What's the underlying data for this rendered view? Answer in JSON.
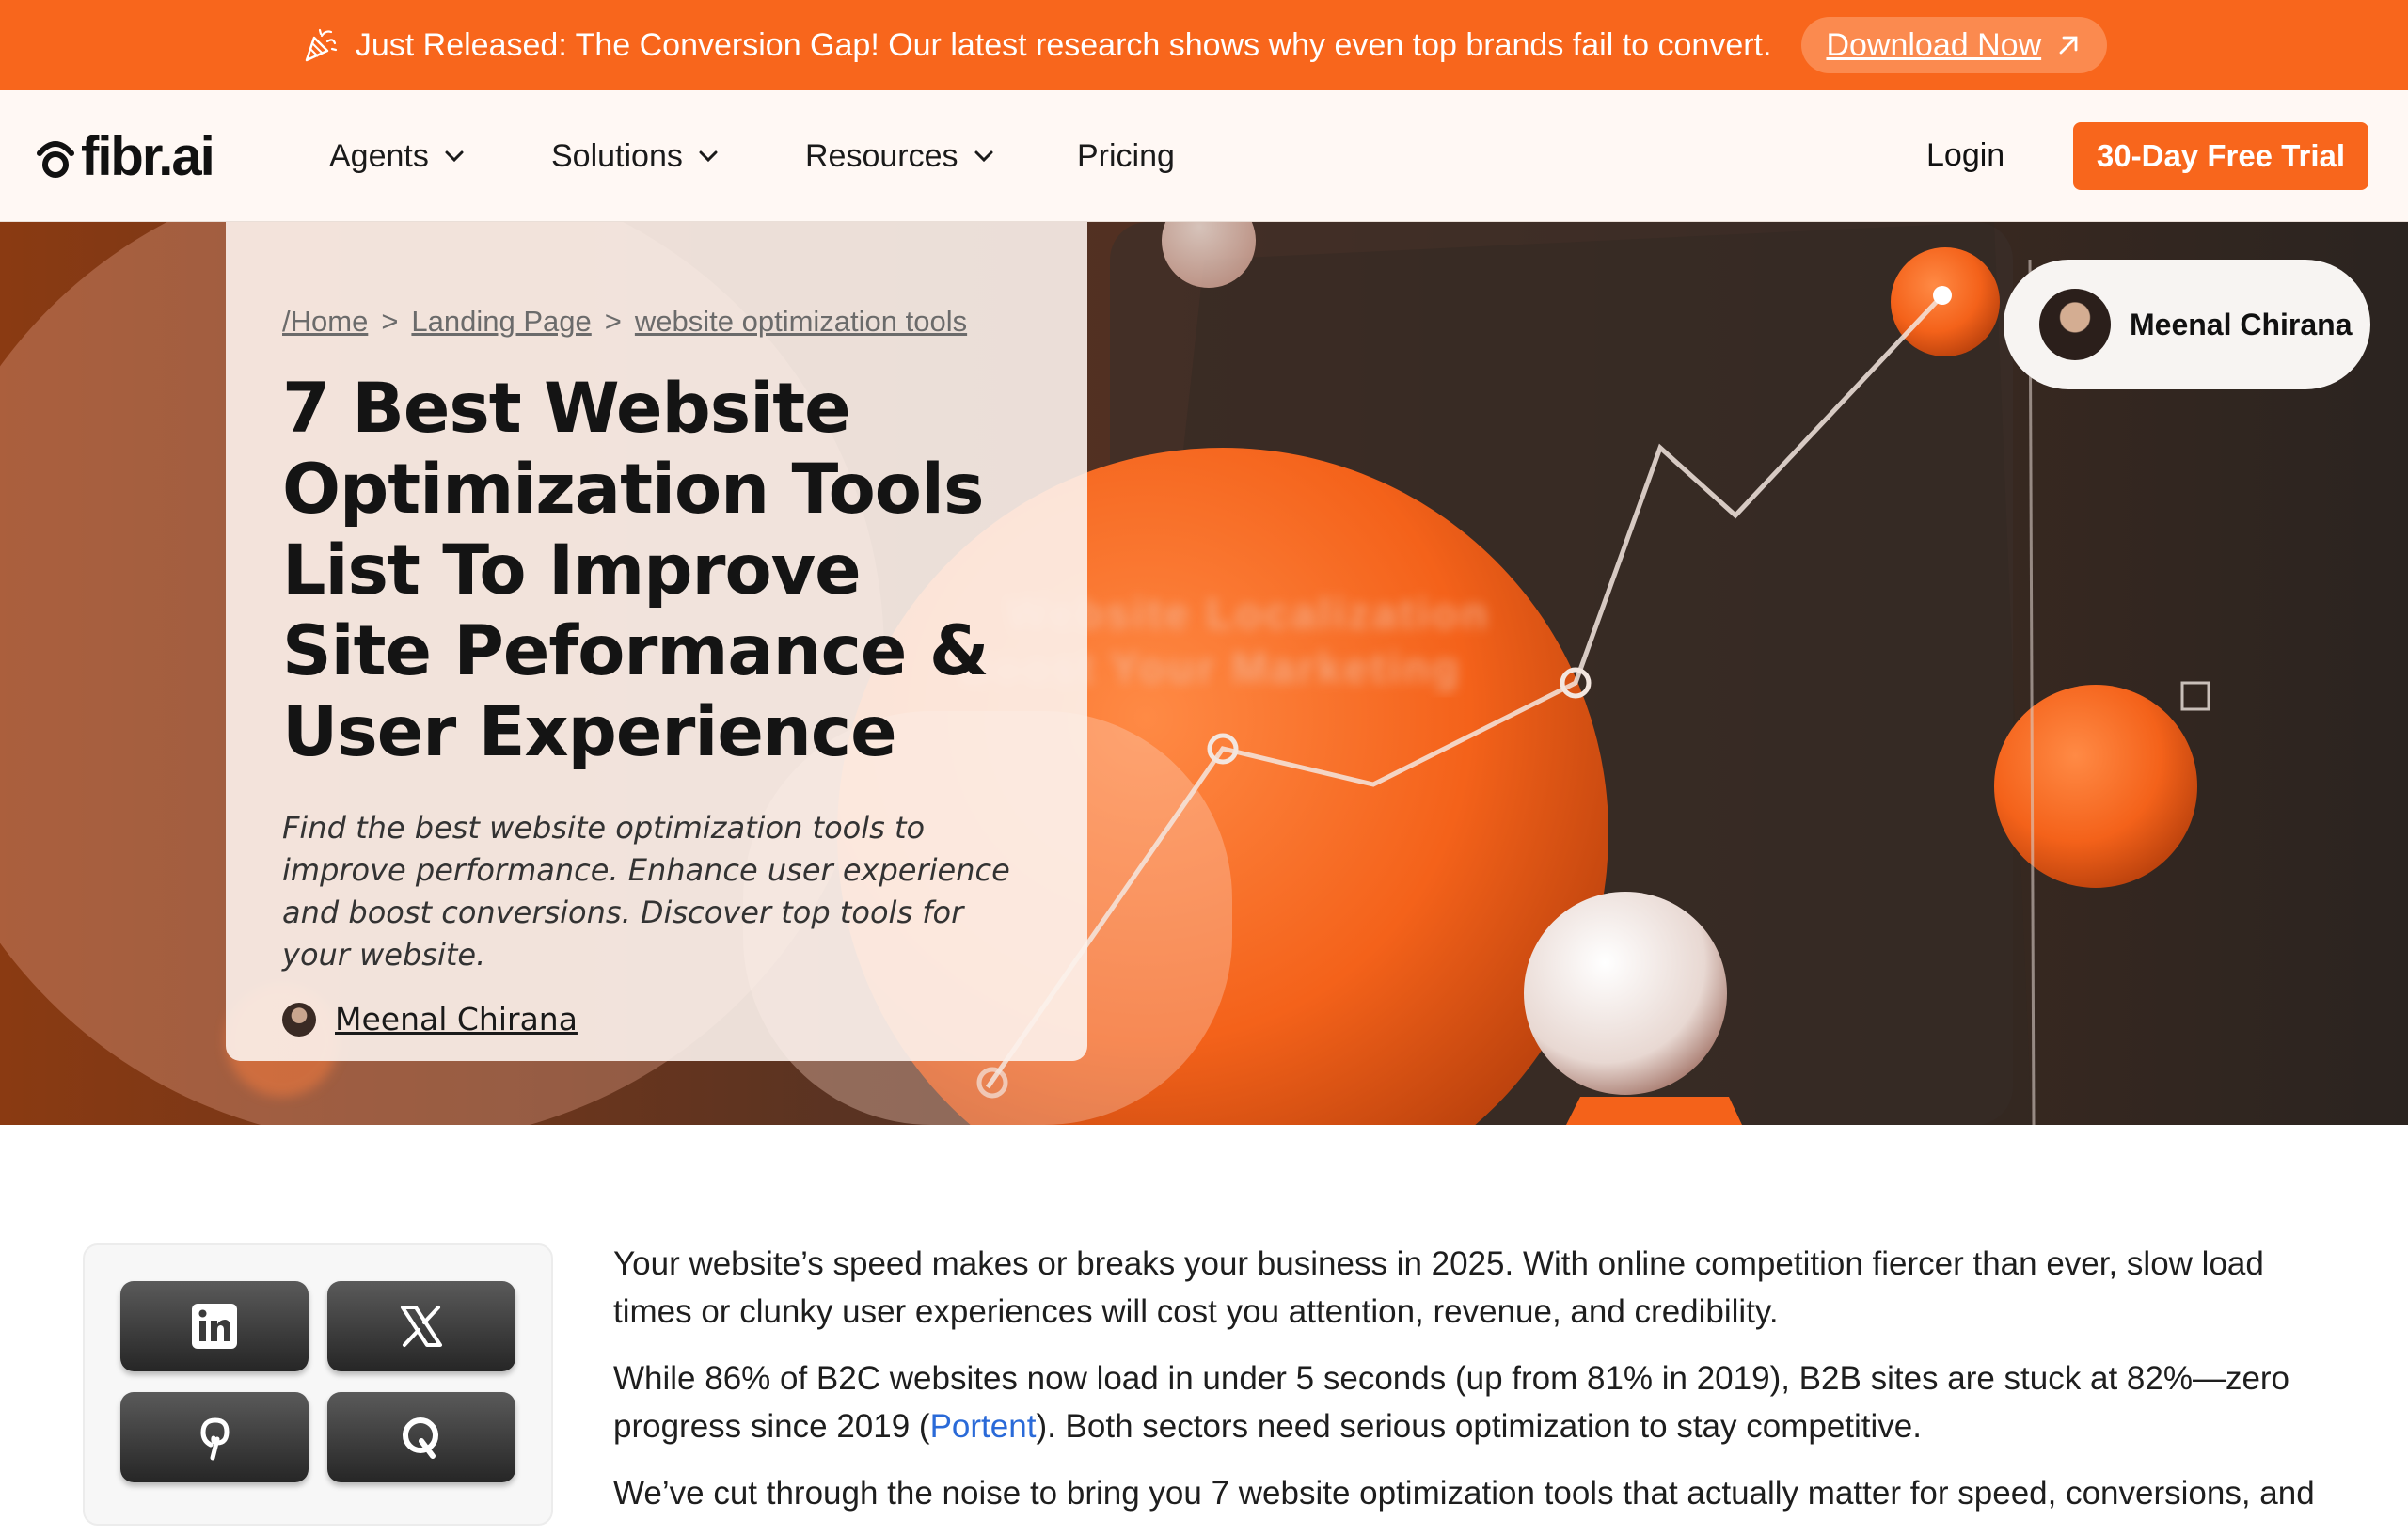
{
  "announcement": {
    "icon": "party-popper-icon",
    "message": "Just Released: The Conversion Gap! Our latest research shows why even top brands fail to convert.",
    "cta_label": "Download Now",
    "cta_icon": "arrow-up-right-icon"
  },
  "nav": {
    "logo_text": "fibr.ai",
    "items": [
      {
        "label": "Agents",
        "has_dropdown": true
      },
      {
        "label": "Solutions",
        "has_dropdown": true
      },
      {
        "label": "Resources",
        "has_dropdown": true
      },
      {
        "label": "Pricing",
        "has_dropdown": false
      }
    ],
    "login_label": "Login",
    "trial_label": "30-Day Free Trial"
  },
  "hero": {
    "breadcrumbs": [
      "/Home",
      "Landing Page",
      "website optimization tools"
    ],
    "breadcrumb_separator": ">",
    "title": "7 Best Website Optimization Tools List To Improve Site Peformance & User Experience",
    "description": "Find the best website optimization tools to improve performance. Enhance user experience and boost conversions. Discover top tools for your website.",
    "author": "Meenal Chirana",
    "author_pill_name": "Meenal Chirana",
    "background_text_line1": "Website  Localization",
    "background_text_line2": "Boost  Your  Marketing"
  },
  "share": {
    "buttons": [
      {
        "icon": "linkedin-icon"
      },
      {
        "icon": "x-twitter-icon"
      },
      {
        "icon": "pinterest-icon"
      },
      {
        "icon": "quora-icon"
      }
    ]
  },
  "article": {
    "p1": "Your website’s speed makes or breaks your business in 2025. With online competition fiercer than ever, slow load times or clunky user experiences will cost you attention, revenue, and credibility.",
    "p2_before": "While 86% of B2C websites now load in under 5 seconds (up from 81% in 2019), B2B sites are stuck at 82%—zero progress since 2019 (",
    "p2_link": "Portent",
    "p2_after": "). Both sectors need serious optimization to stay competitive.",
    "p3": "We’ve cut through the noise to bring you 7 website optimization tools that actually matter for speed, conversions, and"
  },
  "colors": {
    "brand_orange": "#f8661c",
    "nav_bg": "#fff8f4",
    "link_blue": "#2a6ad8"
  }
}
